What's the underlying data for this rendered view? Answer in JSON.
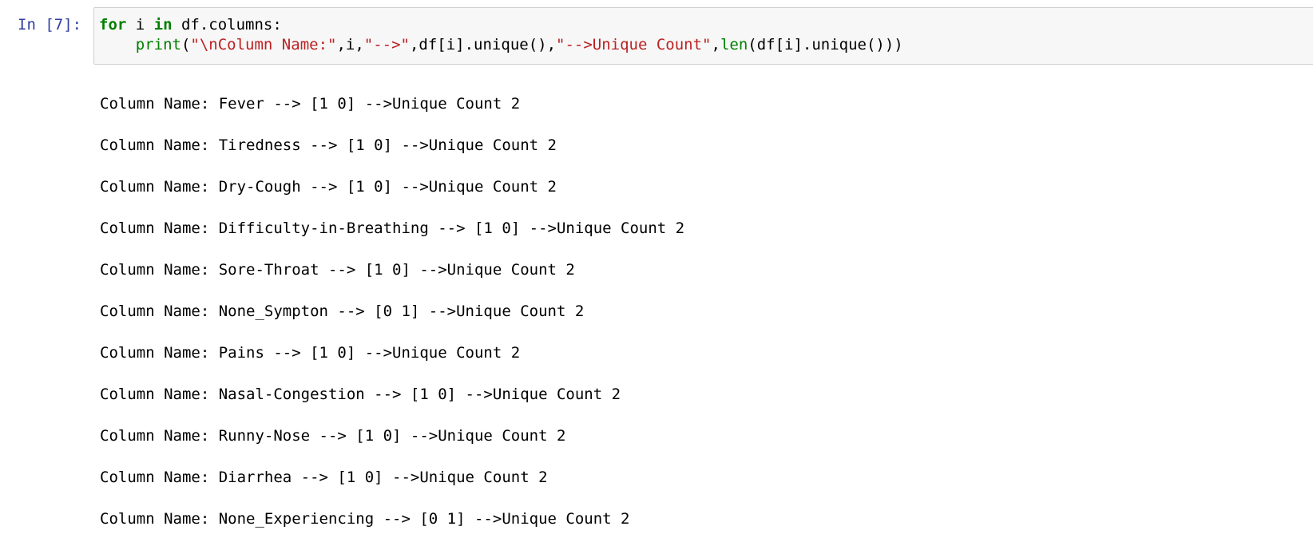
{
  "cell": {
    "prompt": "In [7]:",
    "code": {
      "line1": {
        "kw1": "for",
        "t1": " i ",
        "kw2": "in",
        "t2": " df.columns:"
      },
      "line2": {
        "indent": "    ",
        "fn": "print",
        "t1": "(",
        "s1": "\"\\nColumn Name:\"",
        "t2": ",i,",
        "s2": "\"-->\"",
        "t3": ",df[i].unique(),",
        "s3": "\"-->Unique Count\"",
        "t4": ",",
        "fn2": "len",
        "t5": "(df[i].unique()))"
      }
    },
    "output": [
      "Column Name: Fever --> [1 0] -->Unique Count 2",
      "Column Name: Tiredness --> [1 0] -->Unique Count 2",
      "Column Name: Dry-Cough --> [1 0] -->Unique Count 2",
      "Column Name: Difficulty-in-Breathing --> [1 0] -->Unique Count 2",
      "Column Name: Sore-Throat --> [1 0] -->Unique Count 2",
      "Column Name: None_Sympton --> [0 1] -->Unique Count 2",
      "Column Name: Pains --> [1 0] -->Unique Count 2",
      "Column Name: Nasal-Congestion --> [1 0] -->Unique Count 2",
      "Column Name: Runny-Nose --> [1 0] -->Unique Count 2",
      "Column Name: Diarrhea --> [1 0] -->Unique Count 2",
      "Column Name: None_Experiencing --> [0 1] -->Unique Count 2"
    ]
  },
  "colors": {
    "prompt": "#303f9f",
    "keyword": "#008000",
    "string": "#ba2121",
    "cell_background": "#f7f7f7",
    "cell_border": "#cfcfcf"
  }
}
